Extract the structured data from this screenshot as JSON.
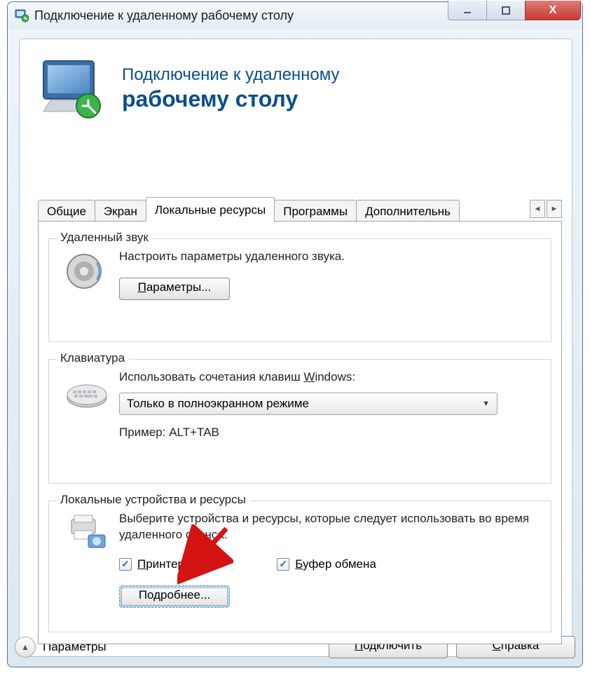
{
  "titlebar": {
    "title": "Подключение к удаленному рабочему столу"
  },
  "banner": {
    "line1": "Подключение к удаленному",
    "line2": "рабочему столу"
  },
  "tabs": {
    "items": [
      "Общие",
      "Экран",
      "Локальные ресурсы",
      "Программы",
      "Дополнительнь"
    ],
    "active_index": 2
  },
  "group_audio": {
    "legend": "Удаленный звук",
    "desc": "Настроить параметры удаленного звука.",
    "button": "Параметры..."
  },
  "group_keyboard": {
    "legend": "Клавиатура",
    "desc_pre": "Использовать сочетания клавиш ",
    "desc_hot": "W",
    "desc_post": "indows:",
    "combo_value": "Только в полноэкранном режиме",
    "example": "Пример: ALT+TAB"
  },
  "group_devices": {
    "legend": "Локальные устройства и ресурсы",
    "desc": "Выберите устройства и ресурсы, которые следует использовать во время удаленного сеанса.",
    "chk1_pre": "П",
    "chk1_post": "ринтеры",
    "chk2_pre": "Б",
    "chk2_post": "уфер обмена",
    "button": "Подробнее..."
  },
  "footer": {
    "options": "Параметры",
    "connect_pre": "П",
    "connect_post": "одключить",
    "help_pre": "С",
    "help_post": "правка"
  },
  "win_btn_close": "X"
}
